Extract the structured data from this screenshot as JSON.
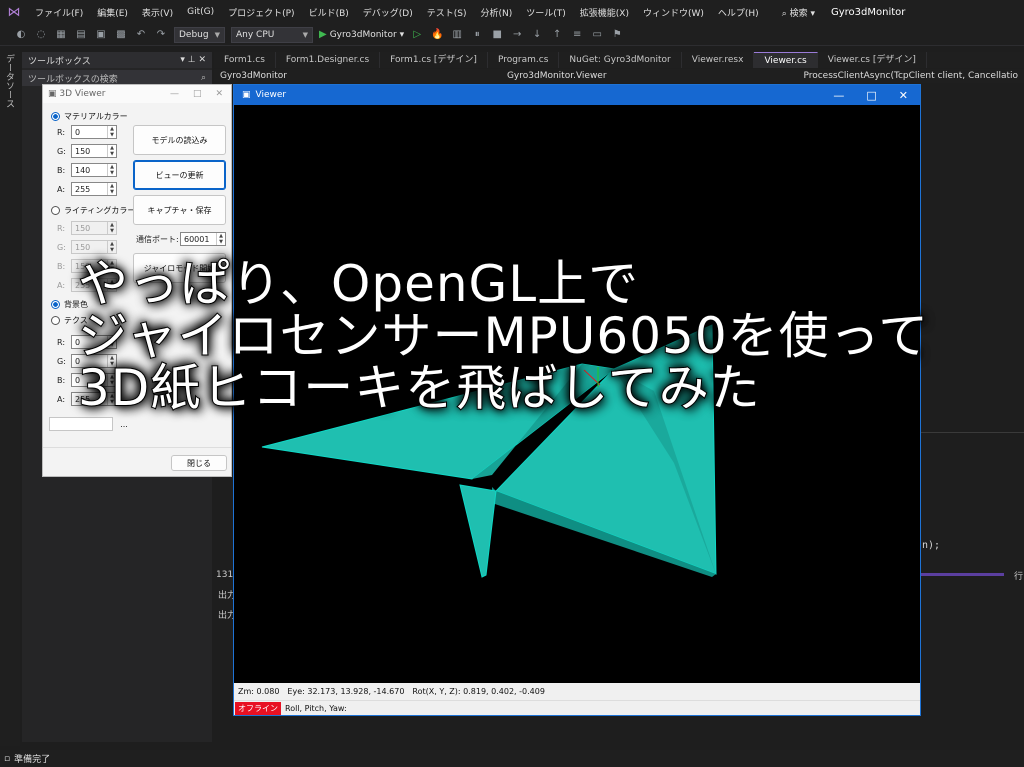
{
  "menubar": {
    "items": [
      "ファイル(F)",
      "編集(E)",
      "表示(V)",
      "Git(G)",
      "プロジェクト(P)",
      "ビルド(B)",
      "デバッグ(D)",
      "テスト(S)",
      "分析(N)",
      "ツール(T)",
      "拡張機能(X)",
      "ウィンドウ(W)",
      "ヘルプ(H)"
    ],
    "search": "検索",
    "app_name": "Gyro3dMonitor"
  },
  "toolbar": {
    "config": "Debug",
    "platform": "Any CPU",
    "run_target": "Gyro3dMonitor"
  },
  "rail": {
    "label": "データソース"
  },
  "toolbox": {
    "title": "ツールボックス",
    "search_placeholder": "ツールボックスの検索"
  },
  "tabs": [
    "Form1.cs",
    "Form1.Designer.cs",
    "Form1.cs [デザイン]",
    "Program.cs",
    "NuGet: Gyro3dMonitor",
    "Viewer.resx",
    "Viewer.cs",
    "Viewer.cs [デザイン]"
  ],
  "navbar": {
    "project": "Gyro3dMonitor",
    "class": "Gyro3dMonitor.Viewer",
    "member": "ProcessClientAsync(TcpClient client, Cancellatio"
  },
  "editor": {
    "code_fragment": "n);",
    "status_left": "131",
    "status_right": "行:",
    "output_title": "出力",
    "output_sub": "出力"
  },
  "statusbar": {
    "text": "準備完了"
  },
  "dialog": {
    "title": "3D Viewer",
    "material_label": "マテリアルカラー",
    "material": {
      "R": "0",
      "G": "150",
      "B": "140",
      "A": "255"
    },
    "lighting_label": "ライティングカラー",
    "lighting": {
      "R": "150",
      "G": "150",
      "B": "150",
      "A": "255"
    },
    "background_label": "背景色",
    "texture_label": "テクス",
    "texture": {
      "R": "0",
      "G": "0",
      "B": "0",
      "A": "255"
    },
    "btn_load": "モデルの読込み",
    "btn_refresh": "ビューの更新",
    "btn_capture": "キャプチャ・保存",
    "port_label": "通信ポート:",
    "port_value": "60001",
    "btn_gyro": "ジャイロモード開始",
    "browse": "...",
    "btn_close": "閉じる"
  },
  "viewer": {
    "title": "Viewer",
    "info": {
      "zm": "Zm: 0.080",
      "eye": "Eye: 32.173, 13.928, -14.670",
      "rot": "Rot(X, Y, Z): 0.819, 0.402, -0.409"
    },
    "status_offline": "オフライン",
    "status_text": "Roll, Pitch, Yaw:"
  },
  "caption": {
    "line1": "やっぱり、OpenGL上で",
    "line2": "ジャイロセンサーMPU6050を使って",
    "line3": "3D紙ヒコーキを飛ばしてみた"
  },
  "colors": {
    "plane": "#1fbfb0",
    "plane_dark": "#138c82",
    "vs_accent": "#9a7bd8",
    "viewer_title": "#1668d1",
    "offline": "#e81123"
  }
}
